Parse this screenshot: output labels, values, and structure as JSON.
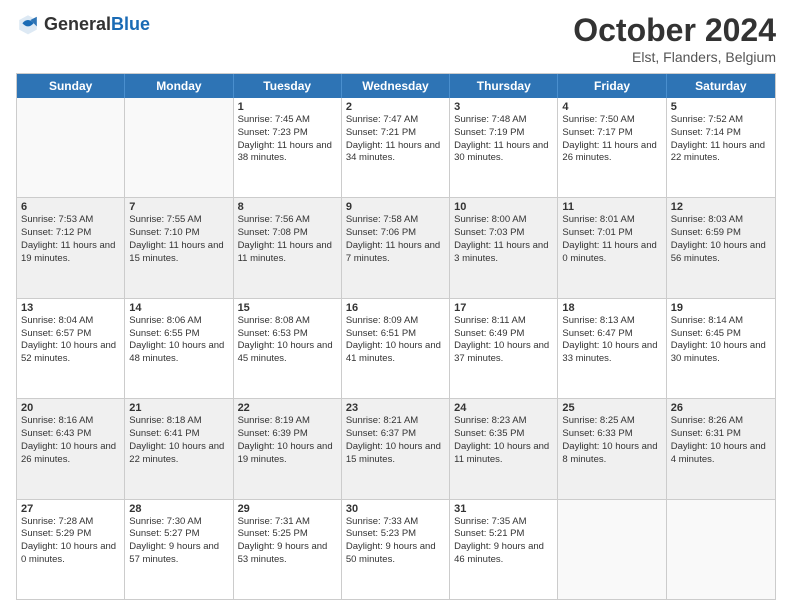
{
  "header": {
    "logo_general": "General",
    "logo_blue": "Blue",
    "month": "October 2024",
    "location": "Elst, Flanders, Belgium"
  },
  "days_of_week": [
    "Sunday",
    "Monday",
    "Tuesday",
    "Wednesday",
    "Thursday",
    "Friday",
    "Saturday"
  ],
  "rows": [
    [
      {
        "day": "",
        "empty": true
      },
      {
        "day": "",
        "empty": true
      },
      {
        "day": "1",
        "sunrise": "Sunrise: 7:45 AM",
        "sunset": "Sunset: 7:23 PM",
        "daylight": "Daylight: 11 hours and 38 minutes."
      },
      {
        "day": "2",
        "sunrise": "Sunrise: 7:47 AM",
        "sunset": "Sunset: 7:21 PM",
        "daylight": "Daylight: 11 hours and 34 minutes."
      },
      {
        "day": "3",
        "sunrise": "Sunrise: 7:48 AM",
        "sunset": "Sunset: 7:19 PM",
        "daylight": "Daylight: 11 hours and 30 minutes."
      },
      {
        "day": "4",
        "sunrise": "Sunrise: 7:50 AM",
        "sunset": "Sunset: 7:17 PM",
        "daylight": "Daylight: 11 hours and 26 minutes."
      },
      {
        "day": "5",
        "sunrise": "Sunrise: 7:52 AM",
        "sunset": "Sunset: 7:14 PM",
        "daylight": "Daylight: 11 hours and 22 minutes."
      }
    ],
    [
      {
        "day": "6",
        "sunrise": "Sunrise: 7:53 AM",
        "sunset": "Sunset: 7:12 PM",
        "daylight": "Daylight: 11 hours and 19 minutes."
      },
      {
        "day": "7",
        "sunrise": "Sunrise: 7:55 AM",
        "sunset": "Sunset: 7:10 PM",
        "daylight": "Daylight: 11 hours and 15 minutes."
      },
      {
        "day": "8",
        "sunrise": "Sunrise: 7:56 AM",
        "sunset": "Sunset: 7:08 PM",
        "daylight": "Daylight: 11 hours and 11 minutes."
      },
      {
        "day": "9",
        "sunrise": "Sunrise: 7:58 AM",
        "sunset": "Sunset: 7:06 PM",
        "daylight": "Daylight: 11 hours and 7 minutes."
      },
      {
        "day": "10",
        "sunrise": "Sunrise: 8:00 AM",
        "sunset": "Sunset: 7:03 PM",
        "daylight": "Daylight: 11 hours and 3 minutes."
      },
      {
        "day": "11",
        "sunrise": "Sunrise: 8:01 AM",
        "sunset": "Sunset: 7:01 PM",
        "daylight": "Daylight: 11 hours and 0 minutes."
      },
      {
        "day": "12",
        "sunrise": "Sunrise: 8:03 AM",
        "sunset": "Sunset: 6:59 PM",
        "daylight": "Daylight: 10 hours and 56 minutes."
      }
    ],
    [
      {
        "day": "13",
        "sunrise": "Sunrise: 8:04 AM",
        "sunset": "Sunset: 6:57 PM",
        "daylight": "Daylight: 10 hours and 52 minutes."
      },
      {
        "day": "14",
        "sunrise": "Sunrise: 8:06 AM",
        "sunset": "Sunset: 6:55 PM",
        "daylight": "Daylight: 10 hours and 48 minutes."
      },
      {
        "day": "15",
        "sunrise": "Sunrise: 8:08 AM",
        "sunset": "Sunset: 6:53 PM",
        "daylight": "Daylight: 10 hours and 45 minutes."
      },
      {
        "day": "16",
        "sunrise": "Sunrise: 8:09 AM",
        "sunset": "Sunset: 6:51 PM",
        "daylight": "Daylight: 10 hours and 41 minutes."
      },
      {
        "day": "17",
        "sunrise": "Sunrise: 8:11 AM",
        "sunset": "Sunset: 6:49 PM",
        "daylight": "Daylight: 10 hours and 37 minutes."
      },
      {
        "day": "18",
        "sunrise": "Sunrise: 8:13 AM",
        "sunset": "Sunset: 6:47 PM",
        "daylight": "Daylight: 10 hours and 33 minutes."
      },
      {
        "day": "19",
        "sunrise": "Sunrise: 8:14 AM",
        "sunset": "Sunset: 6:45 PM",
        "daylight": "Daylight: 10 hours and 30 minutes."
      }
    ],
    [
      {
        "day": "20",
        "sunrise": "Sunrise: 8:16 AM",
        "sunset": "Sunset: 6:43 PM",
        "daylight": "Daylight: 10 hours and 26 minutes."
      },
      {
        "day": "21",
        "sunrise": "Sunrise: 8:18 AM",
        "sunset": "Sunset: 6:41 PM",
        "daylight": "Daylight: 10 hours and 22 minutes."
      },
      {
        "day": "22",
        "sunrise": "Sunrise: 8:19 AM",
        "sunset": "Sunset: 6:39 PM",
        "daylight": "Daylight: 10 hours and 19 minutes."
      },
      {
        "day": "23",
        "sunrise": "Sunrise: 8:21 AM",
        "sunset": "Sunset: 6:37 PM",
        "daylight": "Daylight: 10 hours and 15 minutes."
      },
      {
        "day": "24",
        "sunrise": "Sunrise: 8:23 AM",
        "sunset": "Sunset: 6:35 PM",
        "daylight": "Daylight: 10 hours and 11 minutes."
      },
      {
        "day": "25",
        "sunrise": "Sunrise: 8:25 AM",
        "sunset": "Sunset: 6:33 PM",
        "daylight": "Daylight: 10 hours and 8 minutes."
      },
      {
        "day": "26",
        "sunrise": "Sunrise: 8:26 AM",
        "sunset": "Sunset: 6:31 PM",
        "daylight": "Daylight: 10 hours and 4 minutes."
      }
    ],
    [
      {
        "day": "27",
        "sunrise": "Sunrise: 7:28 AM",
        "sunset": "Sunset: 5:29 PM",
        "daylight": "Daylight: 10 hours and 0 minutes."
      },
      {
        "day": "28",
        "sunrise": "Sunrise: 7:30 AM",
        "sunset": "Sunset: 5:27 PM",
        "daylight": "Daylight: 9 hours and 57 minutes."
      },
      {
        "day": "29",
        "sunrise": "Sunrise: 7:31 AM",
        "sunset": "Sunset: 5:25 PM",
        "daylight": "Daylight: 9 hours and 53 minutes."
      },
      {
        "day": "30",
        "sunrise": "Sunrise: 7:33 AM",
        "sunset": "Sunset: 5:23 PM",
        "daylight": "Daylight: 9 hours and 50 minutes."
      },
      {
        "day": "31",
        "sunrise": "Sunrise: 7:35 AM",
        "sunset": "Sunset: 5:21 PM",
        "daylight": "Daylight: 9 hours and 46 minutes."
      },
      {
        "day": "",
        "empty": true
      },
      {
        "day": "",
        "empty": true
      }
    ]
  ]
}
